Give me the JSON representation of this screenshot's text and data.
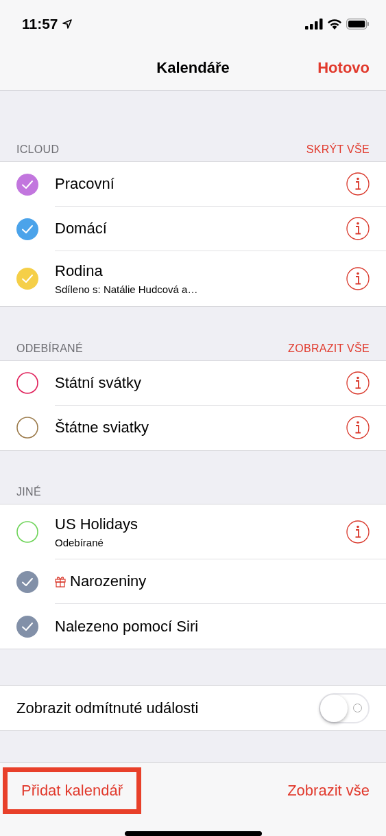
{
  "status_bar": {
    "time": "11:57"
  },
  "nav": {
    "title": "Kalendáře",
    "done": "Hotovo"
  },
  "sections": [
    {
      "title": "ICLOUD",
      "action": "SKRÝT VŠE",
      "calendars": [
        {
          "name": "Pracovní",
          "color": "#c276de",
          "checked": true,
          "info": true
        },
        {
          "name": "Domácí",
          "color": "#4ba3ea",
          "checked": true,
          "info": true
        },
        {
          "name": "Rodina",
          "subtitle": "Sdíleno s: Natálie Hudcová a…",
          "color": "#f5cf48",
          "checked": true,
          "info": true
        }
      ]
    },
    {
      "title": "ODEBÍRANÉ",
      "action": "ZOBRAZIT VŠE",
      "calendars": [
        {
          "name": "Státní svátky",
          "color": "#e0205a",
          "checked": false,
          "info": true
        },
        {
          "name": "Štátne sviatky",
          "color": "#9d7d4e",
          "checked": false,
          "info": true
        }
      ]
    },
    {
      "title": "JINÉ",
      "calendars": [
        {
          "name": "US Holidays",
          "subtitle": "Odebírané",
          "color": "#6fd45a",
          "checked": false,
          "info": true
        },
        {
          "name": "Narozeniny",
          "kind": "birthday",
          "color": "#8290a8",
          "checked": true,
          "info": false
        },
        {
          "name": "Nalezeno pomocí Siri",
          "color": "#8290a8",
          "checked": true,
          "info": false
        }
      ]
    }
  ],
  "declined": {
    "label": "Zobrazit odmítnuté události",
    "on": false
  },
  "footer": {
    "add": {
      "label": "Přidat kalendář",
      "highlighted": true
    },
    "show_all": "Zobrazit vše"
  }
}
